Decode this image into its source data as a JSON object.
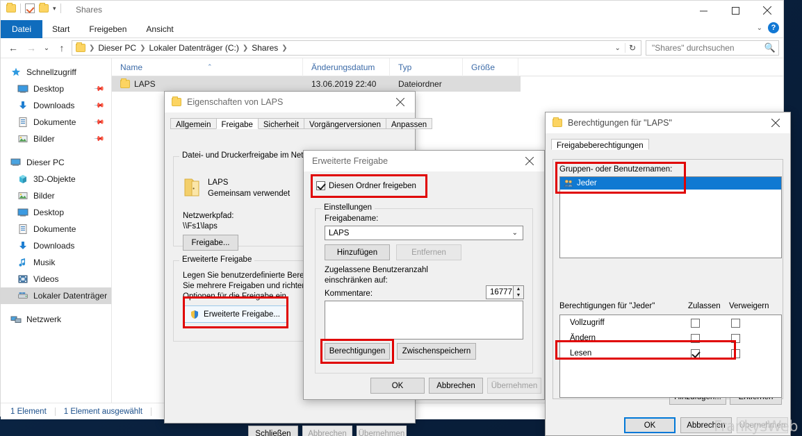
{
  "explorer": {
    "titlebar": {
      "title": "Shares"
    },
    "window_controls": {
      "minimize": "minimize-icon",
      "maximize": "maximize-icon",
      "close": "close-icon"
    },
    "ribbon_tabs": [
      "Datei",
      "Start",
      "Freigeben",
      "Ansicht"
    ],
    "address": {
      "crumbs": [
        "Dieser PC",
        "Lokaler Datenträger (C:)",
        "Shares"
      ],
      "refresh_icon": "refresh-icon"
    },
    "search": {
      "placeholder": "\"Shares\" durchsuchen",
      "value": ""
    },
    "sidebar": {
      "groups": [
        {
          "label": "Schnellzugriff",
          "icon": "star-icon",
          "items": [
            {
              "label": "Desktop",
              "icon": "monitor-icon",
              "pinned": true
            },
            {
              "label": "Downloads",
              "icon": "download-icon",
              "pinned": true
            },
            {
              "label": "Dokumente",
              "icon": "document-icon",
              "pinned": true
            },
            {
              "label": "Bilder",
              "icon": "picture-icon",
              "pinned": true
            }
          ]
        },
        {
          "label": "Dieser PC",
          "icon": "pc-icon",
          "items": [
            {
              "label": "3D-Objekte",
              "icon": "cube-icon",
              "pinned": false
            },
            {
              "label": "Bilder",
              "icon": "picture-icon",
              "pinned": false
            },
            {
              "label": "Desktop",
              "icon": "monitor-icon",
              "pinned": false
            },
            {
              "label": "Dokumente",
              "icon": "document-icon",
              "pinned": false
            },
            {
              "label": "Downloads",
              "icon": "download-icon",
              "pinned": false
            },
            {
              "label": "Musik",
              "icon": "music-icon",
              "pinned": false
            },
            {
              "label": "Videos",
              "icon": "video-icon",
              "pinned": false
            },
            {
              "label": "Lokaler Datenträger",
              "icon": "drive-icon",
              "pinned": false,
              "selected": true
            }
          ]
        },
        {
          "label": "Netzwerk",
          "icon": "network-icon",
          "items": []
        }
      ]
    },
    "columns": [
      "Name",
      "Änderungsdatum",
      "Typ",
      "Größe"
    ],
    "rows": [
      {
        "name": "LAPS",
        "modified": "13.06.2019 22:40",
        "type": "Dateiordner",
        "size": "",
        "selected": true
      }
    ],
    "status": {
      "count": "1 Element",
      "selection": "1 Element ausgewählt"
    }
  },
  "properties_dialog": {
    "title": "Eigenschaften von LAPS",
    "tabs": [
      "Allgemein",
      "Freigabe",
      "Sicherheit",
      "Vorgängerversionen",
      "Anpassen"
    ],
    "active_tab": "Freigabe",
    "network_group": {
      "legend": "Datei- und Druckerfreigabe im Netzwerk",
      "share_name": "LAPS",
      "share_state": "Gemeinsam verwendet",
      "path_label": "Netzwerkpfad:",
      "path_value": "\\\\Fs1\\laps",
      "share_button": "Freigabe..."
    },
    "advanced_group": {
      "legend": "Erweiterte Freigabe",
      "description": "Legen Sie benutzerdefinierte Berechtigungen fest, erstellen Sie mehrere Freigaben und richten Sie andere erweiterte Optionen für die Freigabe ein.",
      "button": "Erweiterte Freigabe..."
    },
    "buttons": {
      "close": "Schließen",
      "cancel": "Abbrechen",
      "apply": "Übernehmen"
    }
  },
  "advanced_share_dialog": {
    "title": "Erweiterte Freigabe",
    "share_checkbox": {
      "label": "Diesen Ordner freigeben",
      "checked": true
    },
    "settings_group": {
      "legend": "Einstellungen",
      "share_name_label": "Freigabename:",
      "share_name_value": "LAPS",
      "add_button": "Hinzufügen",
      "remove_button": "Entfernen",
      "limit_label": "Zugelassene Benutzeranzahl einschränken auf:",
      "limit_value": "16777",
      "comments_label": "Kommentare:",
      "comments_value": "",
      "permissions_button": "Berechtigungen",
      "caching_button": "Zwischenspeichern"
    },
    "buttons": {
      "ok": "OK",
      "cancel": "Abbrechen",
      "apply": "Übernehmen"
    }
  },
  "permissions_dialog": {
    "title": "Berechtigungen für \"LAPS\"",
    "tab": "Freigabeberechtigungen",
    "group_label": "Gruppen- oder Benutzernamen:",
    "principals": [
      {
        "name": "Jeder",
        "icon": "users-icon",
        "selected": true
      }
    ],
    "add_button": "Hinzufügen...",
    "remove_button": "Entfernen",
    "perm_header": "Berechtigungen für \"Jeder\"",
    "col_allow": "Zulassen",
    "col_deny": "Verweigern",
    "permissions": [
      {
        "name": "Vollzugriff",
        "allow": false,
        "deny": false
      },
      {
        "name": "Ändern",
        "allow": false,
        "deny": false
      },
      {
        "name": "Lesen",
        "allow": true,
        "deny": false
      }
    ],
    "buttons": {
      "ok": "OK",
      "cancel": "Abbrechen",
      "apply": "Übernehmen"
    }
  },
  "watermark": "FrankysWeb",
  "colors": {
    "accent_blue": "#0f6cbd",
    "selection_blue": "#1079d2",
    "highlight_red": "#e00000",
    "desktop_navy": "#0a2240"
  }
}
